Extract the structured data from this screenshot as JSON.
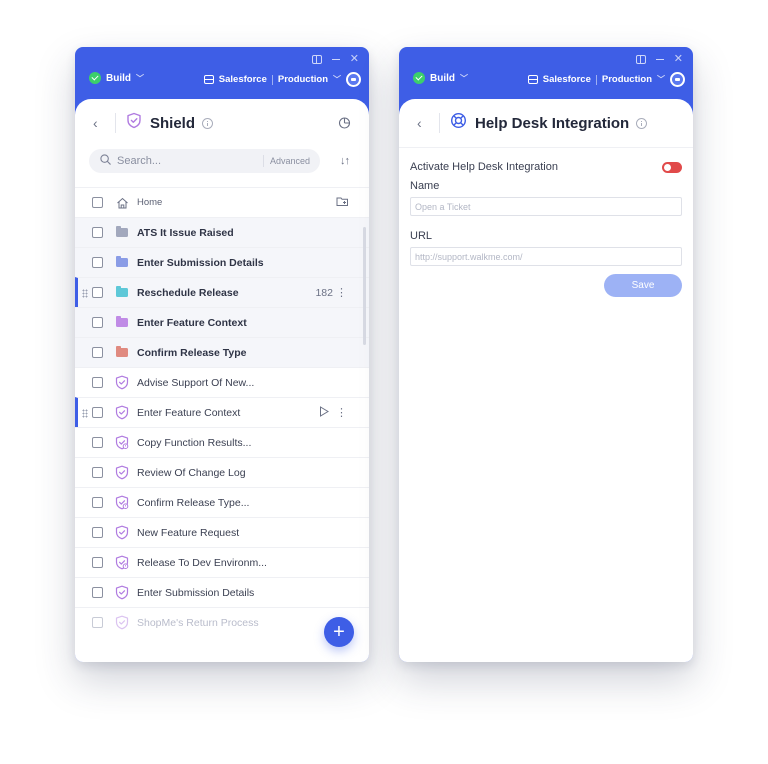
{
  "colors": {
    "brand": "#3e5ee6",
    "toggle_off": "#e14a4a",
    "success": "#3ccf6b"
  },
  "topbar": {
    "build_label": "Build",
    "system": "Salesforce",
    "environment": "Production"
  },
  "left": {
    "title": "Shield",
    "search": {
      "placeholder": "Search...",
      "advanced": "Advanced"
    },
    "home": "Home",
    "items": [
      {
        "label": "ATS It Issue Raised",
        "type": "folder",
        "icon": "folder-icon",
        "color": "#a2a8bd"
      },
      {
        "label": "Enter Submission Details",
        "type": "folder",
        "icon": "folder-icon",
        "color": "#8a9ce6"
      },
      {
        "label": "Reschedule Release",
        "type": "folder",
        "icon": "folder-icon",
        "color": "#5ec8d8",
        "count": "182"
      },
      {
        "label": "Enter Feature Context",
        "type": "folder",
        "icon": "folder-icon",
        "color": "#c08be6"
      },
      {
        "label": "Confirm Release Type",
        "type": "folder",
        "icon": "folder-icon",
        "color": "#e08a80"
      },
      {
        "label": "Advise Support Of New...",
        "type": "shield",
        "icon": "shield-check-icon"
      },
      {
        "label": "Enter Feature Context",
        "type": "shield",
        "icon": "shield-check-icon"
      },
      {
        "label": "Copy Function Results...",
        "type": "shield",
        "icon": "shield-alert-icon"
      },
      {
        "label": "Review Of Change Log",
        "type": "shield",
        "icon": "shield-check-icon"
      },
      {
        "label": "Confirm Release Type...",
        "type": "shield",
        "icon": "shield-alert-icon"
      },
      {
        "label": "New Feature Request",
        "type": "shield",
        "icon": "shield-check-icon"
      },
      {
        "label": "Release To Dev Environm...",
        "type": "shield",
        "icon": "shield-alert-icon"
      },
      {
        "label": "Enter Submission Details",
        "type": "shield",
        "icon": "shield-check-icon"
      },
      {
        "label": "ShopMe's Return Process",
        "type": "shield",
        "icon": "shield-check-icon"
      }
    ]
  },
  "right": {
    "title": "Help Desk Integration",
    "activate_label": "Activate Help Desk Integration",
    "name_label": "Name",
    "name_placeholder": "Open a Ticket",
    "url_label": "URL",
    "url_placeholder": "http://support.walkme.com/",
    "save_label": "Save"
  }
}
